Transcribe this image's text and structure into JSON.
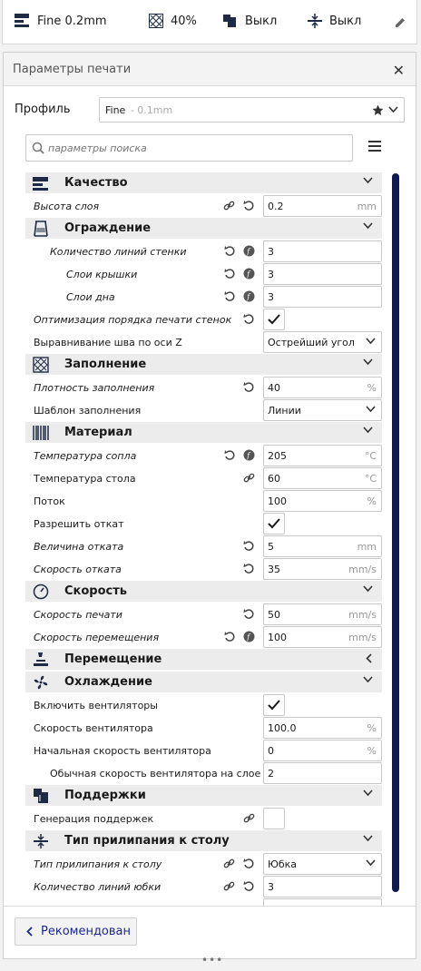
{
  "topbar": {
    "profile": "Fine 0.2mm",
    "infill": "40%",
    "support": "Выкл",
    "adhesion": "Выкл"
  },
  "panel": {
    "title": "Параметры печати",
    "profile_label": "Профиль",
    "profile_value": "Fine",
    "profile_sub": "- 0.1mm",
    "search_placeholder": "параметры поиска"
  },
  "sections": {
    "quality": {
      "label": "Качество",
      "layer_height": {
        "label": "Высота слоя",
        "value": "0.2",
        "unit": "mm"
      }
    },
    "shell": {
      "label": "Ограждение",
      "wall_line_count": {
        "label": "Количество линий стенки",
        "value": "3"
      },
      "top_layers": {
        "label": "Слои крышки",
        "value": "3"
      },
      "bottom_layers": {
        "label": "Слои дна",
        "value": "3"
      },
      "optimize_wall_order": {
        "label": "Оптимизация порядка печати стенок",
        "checked": true
      },
      "seam_align": {
        "label": "Выравнивание шва по оси Z",
        "value": "Острейший угол"
      }
    },
    "infill": {
      "label": "Заполнение",
      "density": {
        "label": "Плотность заполнения",
        "value": "40",
        "unit": "%"
      },
      "pattern": {
        "label": "Шаблон заполнения",
        "value": "Линии"
      }
    },
    "material": {
      "label": "Материал",
      "nozzle_temp": {
        "label": "Температура сопла",
        "value": "205",
        "unit": "°C"
      },
      "bed_temp": {
        "label": "Температура стола",
        "value": "60",
        "unit": "°C"
      },
      "flow": {
        "label": "Поток",
        "value": "100",
        "unit": "%"
      },
      "retraction_enable": {
        "label": "Разрешить откат",
        "checked": true
      },
      "retraction_distance": {
        "label": "Величина отката",
        "value": "5",
        "unit": "mm"
      },
      "retraction_speed": {
        "label": "Скорость отката",
        "value": "35",
        "unit": "mm/s"
      }
    },
    "speed": {
      "label": "Скорость",
      "print_speed": {
        "label": "Скорость печати",
        "value": "50",
        "unit": "mm/s"
      },
      "travel_speed": {
        "label": "Скорость перемещения",
        "value": "100",
        "unit": "mm/s"
      }
    },
    "travel": {
      "label": "Перемещение"
    },
    "cooling": {
      "label": "Охлаждение",
      "fan_enable": {
        "label": "Включить вентиляторы",
        "checked": true
      },
      "fan_speed": {
        "label": "Скорость вентилятора",
        "value": "100.0",
        "unit": "%"
      },
      "initial_fan_speed": {
        "label": "Начальная скорость вентилятора",
        "value": "0",
        "unit": "%"
      },
      "regular_fan_layer": {
        "label": "Обычная скорость вентилятора на слое",
        "value": "2"
      }
    },
    "support": {
      "label": "Поддержки",
      "generate": {
        "label": "Генерация поддержек",
        "checked": false
      }
    },
    "adhesion": {
      "label": "Тип прилипания к столу",
      "type": {
        "label": "Тип прилипания к столу",
        "value": "Юбка"
      },
      "skirt_lines": {
        "label": "Количество линий юбки",
        "value": "3"
      }
    }
  },
  "footer": {
    "recommended_label": "Рекомендован",
    "drag_handle": "•••"
  },
  "colors": {
    "accent": "#0f1a52",
    "link": "#1b2a8e"
  }
}
